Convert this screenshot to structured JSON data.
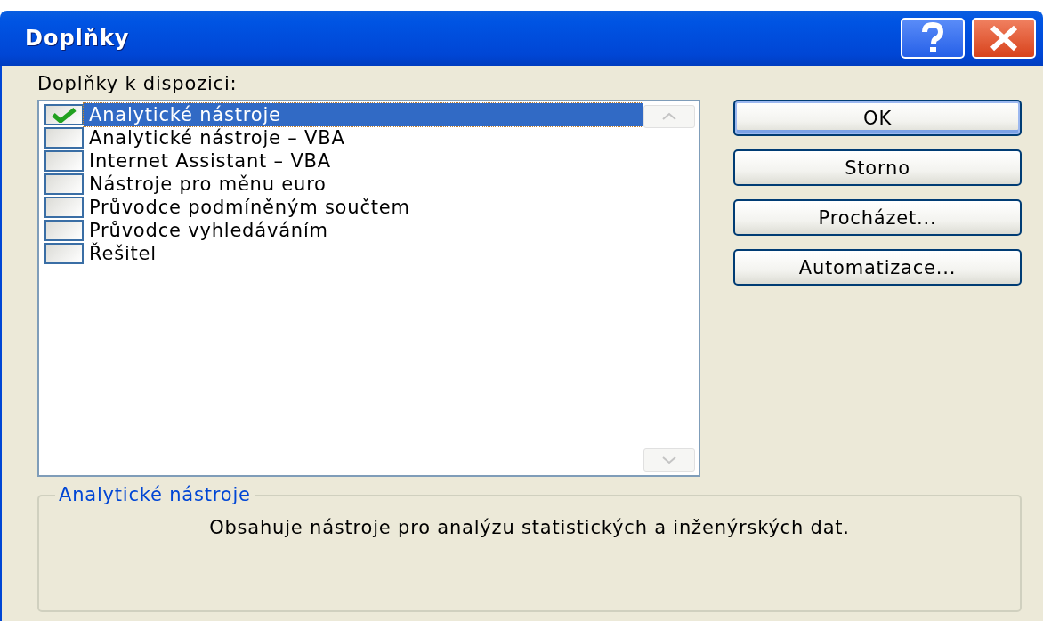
{
  "window": {
    "title": "Doplňky"
  },
  "list_label": "Doplňky k dispozici:",
  "addins": [
    {
      "label": "Analytické nástroje",
      "checked": true,
      "selected": true
    },
    {
      "label": "Analytické nástroje – VBA",
      "checked": false,
      "selected": false
    },
    {
      "label": "Internet Assistant – VBA",
      "checked": false,
      "selected": false
    },
    {
      "label": "Nástroje pro měnu euro",
      "checked": false,
      "selected": false
    },
    {
      "label": "Průvodce podmíněným součtem",
      "checked": false,
      "selected": false
    },
    {
      "label": "Průvodce vyhledáváním",
      "checked": false,
      "selected": false
    },
    {
      "label": "Řešitel",
      "checked": false,
      "selected": false
    }
  ],
  "buttons": [
    {
      "label": "OK",
      "default": true
    },
    {
      "label": "Storno",
      "default": false
    },
    {
      "label": "Procházet...",
      "default": false
    },
    {
      "label": "Automatizace...",
      "default": false
    }
  ],
  "description": {
    "title": "Analytické nástroje",
    "text": "Obsahuje nástroje pro analýzu statistických a inženýrských dat."
  }
}
